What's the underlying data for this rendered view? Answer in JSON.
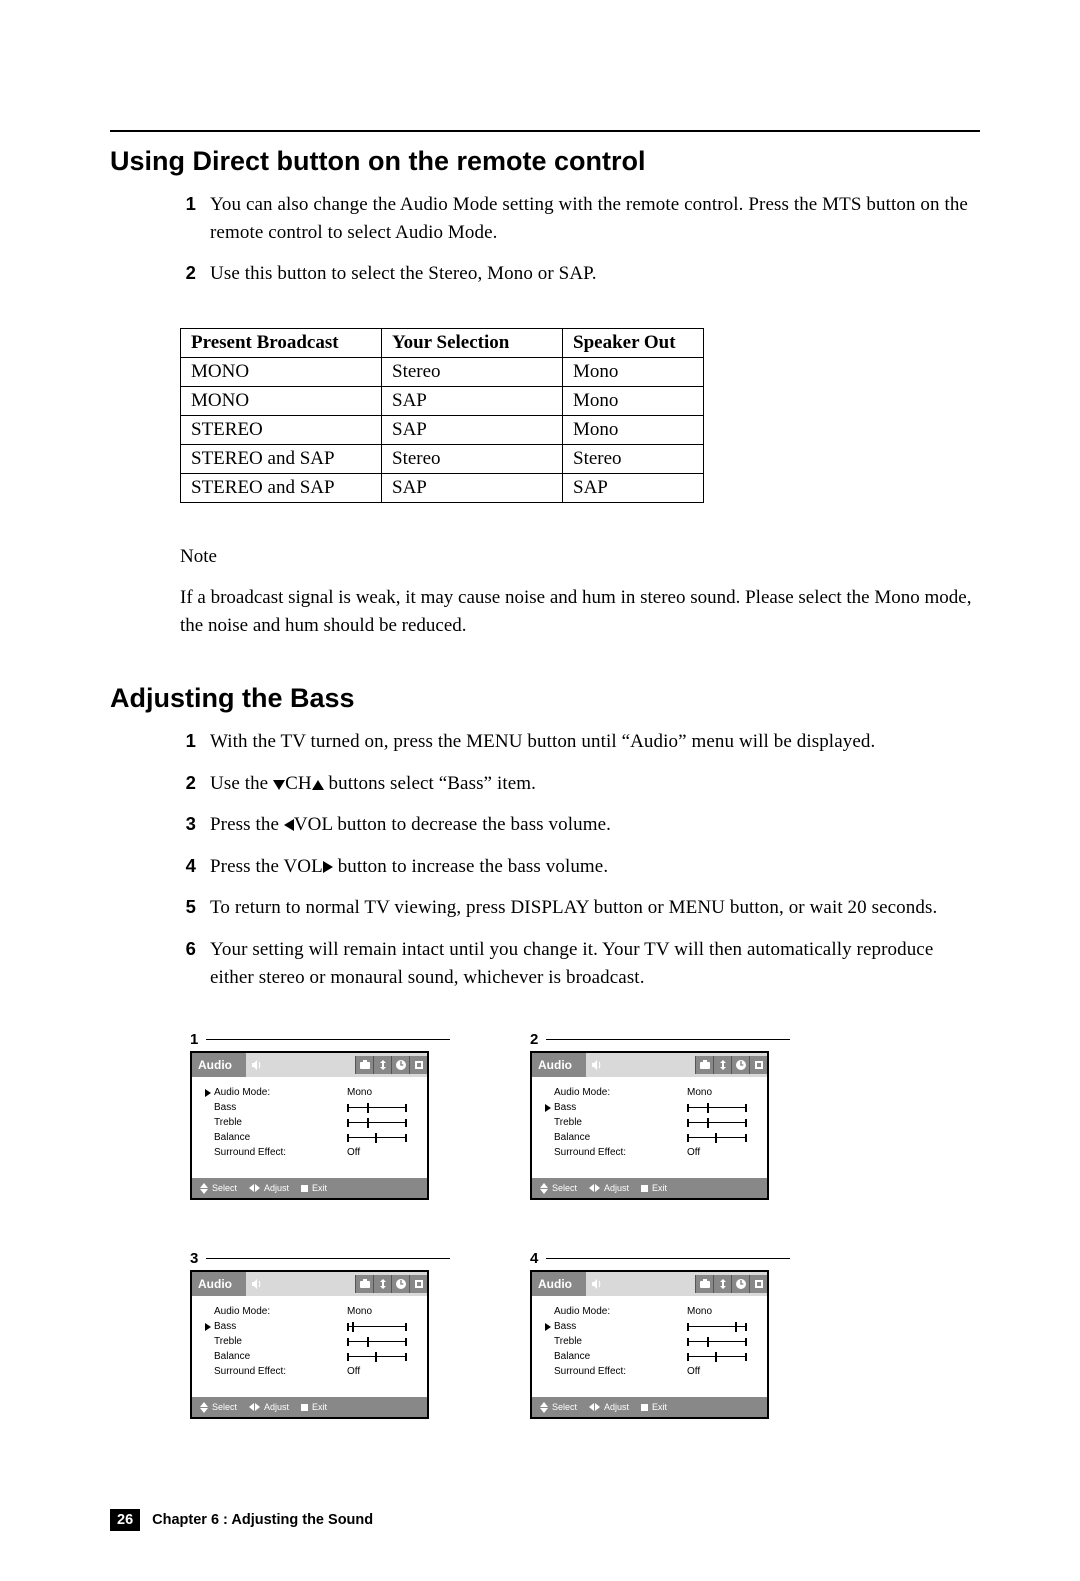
{
  "section1": {
    "heading": "Using Direct button on the remote control",
    "steps": [
      "You can also change the Audio Mode setting with the remote control. Press the MTS button on the remote control to select Audio Mode.",
      "Use this button to select the Stereo, Mono or SAP."
    ]
  },
  "table": {
    "headers": [
      "Present Broadcast",
      "Your Selection",
      "Speaker Out"
    ],
    "rows": [
      [
        "MONO",
        "Stereo",
        "Mono"
      ],
      [
        "MONO",
        "SAP",
        "Mono"
      ],
      [
        "STEREO",
        "SAP",
        "Mono"
      ],
      [
        "STEREO and SAP",
        "Stereo",
        "Stereo"
      ],
      [
        "STEREO and SAP",
        "SAP",
        "SAP"
      ]
    ]
  },
  "note": {
    "label": "Note",
    "text": "If a broadcast signal is weak, it may cause noise and hum in stereo sound. Please select the Mono mode, the noise and hum should be reduced."
  },
  "section2": {
    "heading": "Adjusting the Bass",
    "steps": [
      {
        "pre": "With the TV turned on, press the MENU button until “Audio” menu will be displayed."
      },
      {
        "pre": "Use the ",
        "post": " buttons select “Bass” item.",
        "ch": true
      },
      {
        "pre": "Press the ",
        "vol_left": true,
        "post": "VOL button to decrease the bass volume."
      },
      {
        "pre": "Press the VOL",
        "vol_right": true,
        "post": " button to increase the bass volume."
      },
      {
        "pre": "To return to normal TV viewing, press DISPLAY button or MENU button, or wait 20 seconds."
      },
      {
        "pre": "Your setting will remain intact until you change it. Your TV will then automatically reproduce either stereo or monaural sound, whichever is broadcast."
      }
    ]
  },
  "osd": {
    "title": "Audio",
    "rows": {
      "audioMode": {
        "label": "Audio Mode:",
        "value": "Mono"
      },
      "bass": "Bass",
      "treble": "Treble",
      "balance": "Balance",
      "surround": {
        "label": "Surround Effect:",
        "value": "Off"
      }
    },
    "footer": {
      "select": "Select",
      "adjust": "Adjust",
      "exit": "Exit"
    },
    "panels": [
      {
        "label": "1",
        "selected": "audioMode",
        "bass_thumb": 20
      },
      {
        "label": "2",
        "selected": "bass",
        "bass_thumb": 20
      },
      {
        "label": "3",
        "selected": "bass",
        "bass_thumb": 5
      },
      {
        "label": "4",
        "selected": "bass",
        "bass_thumb": 48
      }
    ]
  },
  "footer": {
    "page": "26",
    "chapter": "Chapter 6 : Adjusting the Sound"
  }
}
